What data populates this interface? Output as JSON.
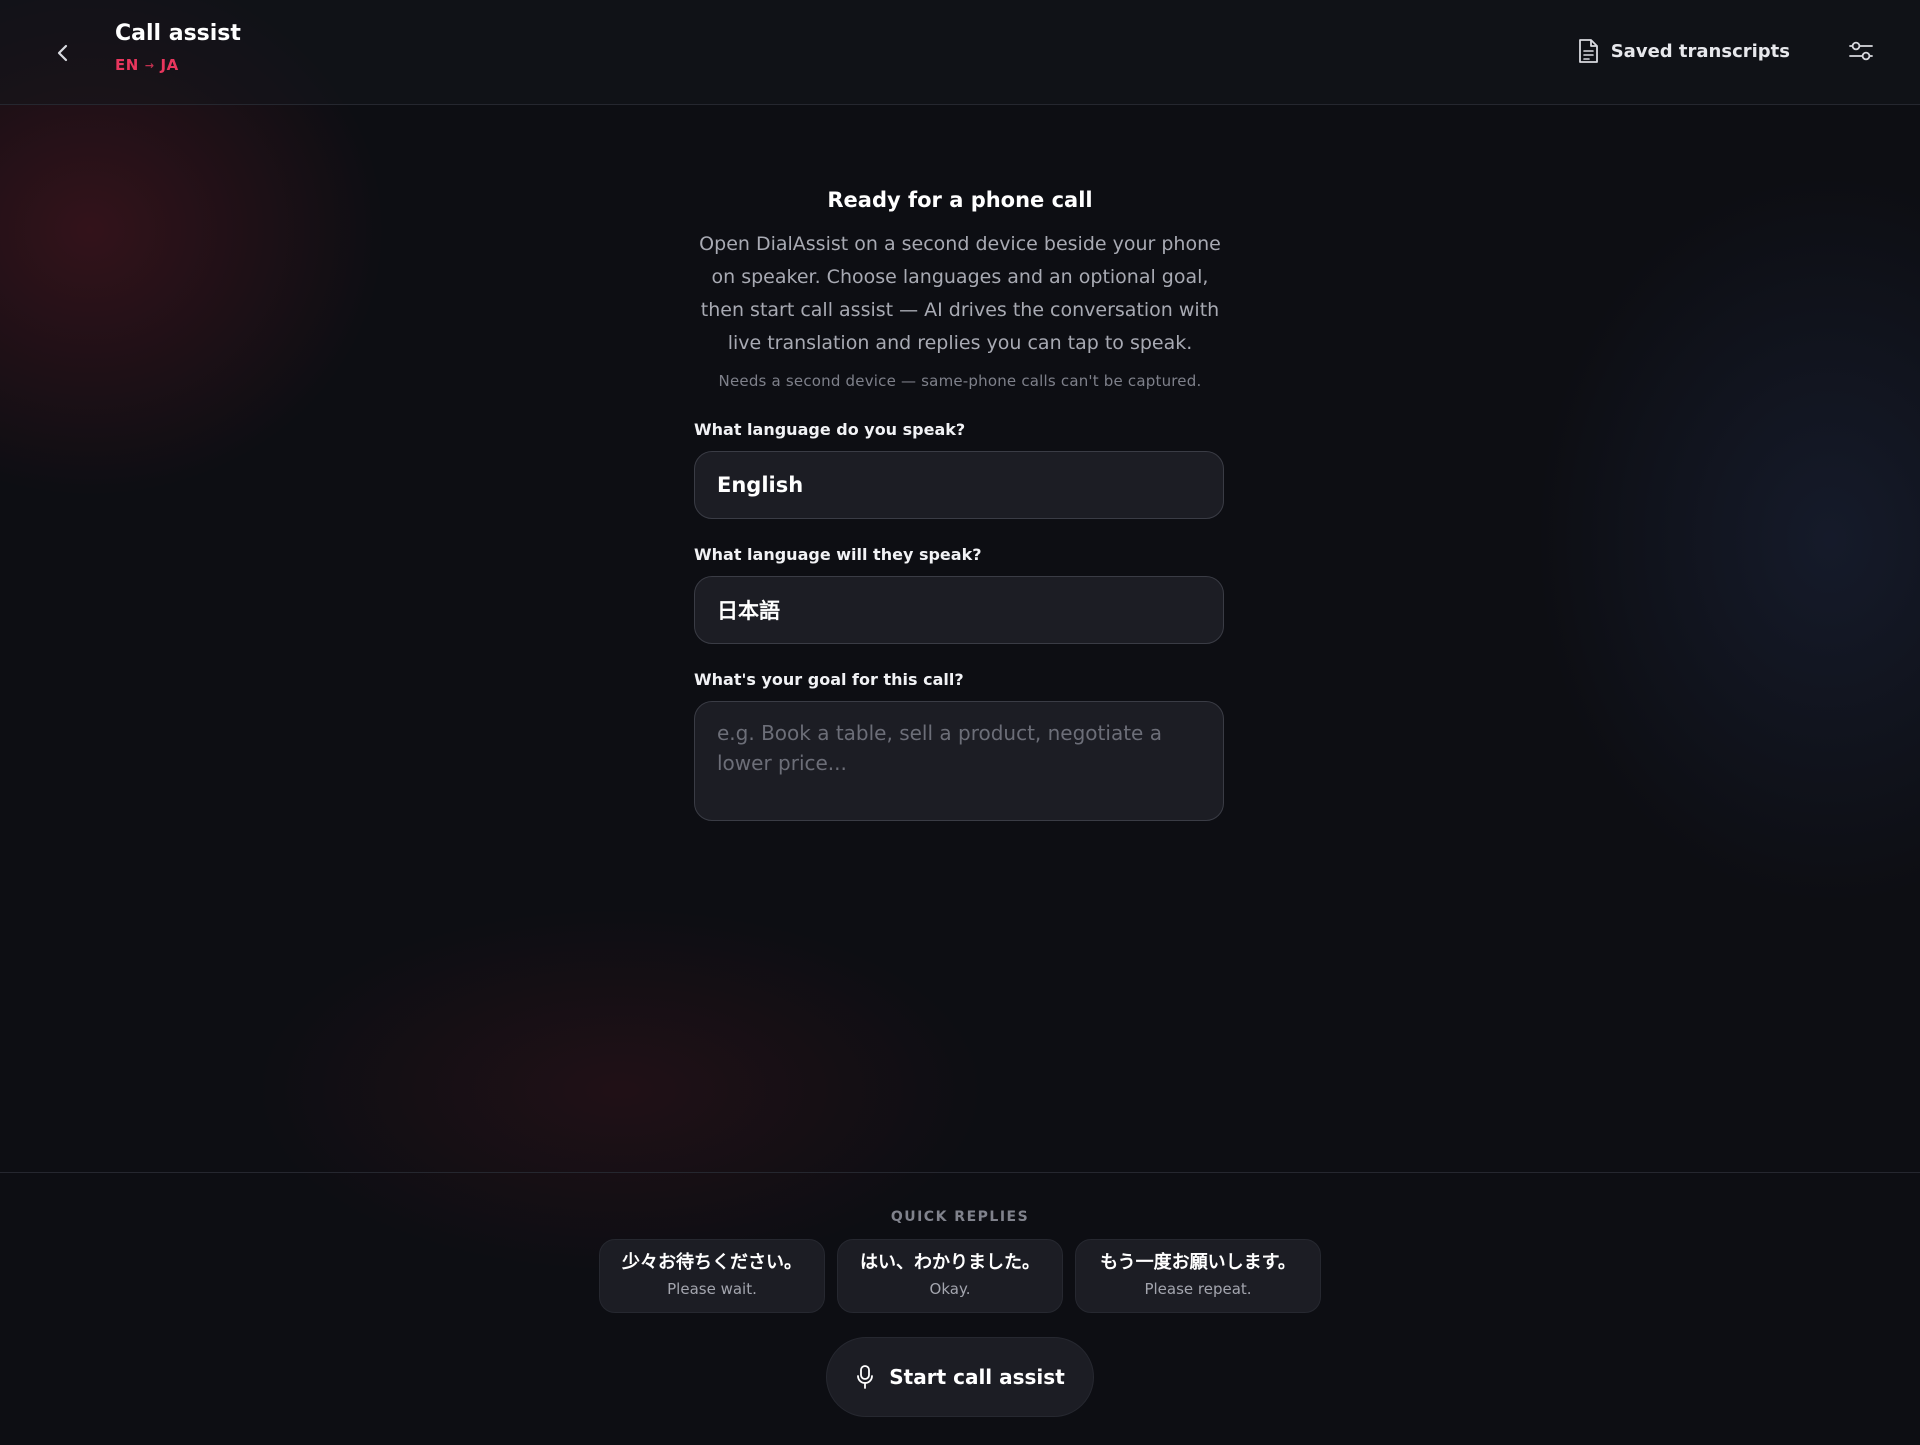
{
  "header": {
    "title": "Call assist",
    "source_lang": "EN",
    "arrow": "→",
    "target_lang": "JA",
    "saved_transcripts_label": "Saved transcripts"
  },
  "main": {
    "heading": "Ready for a phone call",
    "description": "Open DialAssist on a second device beside your phone on speaker. Choose languages and an optional goal, then start call assist — AI drives the conversation with live translation and replies you can tap to speak.",
    "note": "Needs a second device — same-phone calls can't be captured.",
    "your_language_label": "What language do you speak?",
    "your_language_value": "English",
    "their_language_label": "What language will they speak?",
    "their_language_value": "日本語",
    "goal_label": "What's your goal for this call?",
    "goal_placeholder": "e.g. Book a table, sell a product, negotiate a lower price..."
  },
  "quick_replies": {
    "title": "QUICK REPLIES",
    "items": [
      {
        "jp": "少々お待ちください。",
        "en": "Please wait."
      },
      {
        "jp": "はい、わかりました。",
        "en": "Okay."
      },
      {
        "jp": "もう一度お願いします。",
        "en": "Please repeat."
      }
    ]
  },
  "start_button_label": "Start call assist",
  "colors": {
    "background": "#0d0e13",
    "accent": "#e8365d",
    "surface": "#1c1d24",
    "border": "#3a3c45"
  },
  "icons": {
    "back": "chevron-left-icon",
    "saved": "document-icon",
    "settings": "sliders-icon",
    "start": "microphone-icon"
  }
}
